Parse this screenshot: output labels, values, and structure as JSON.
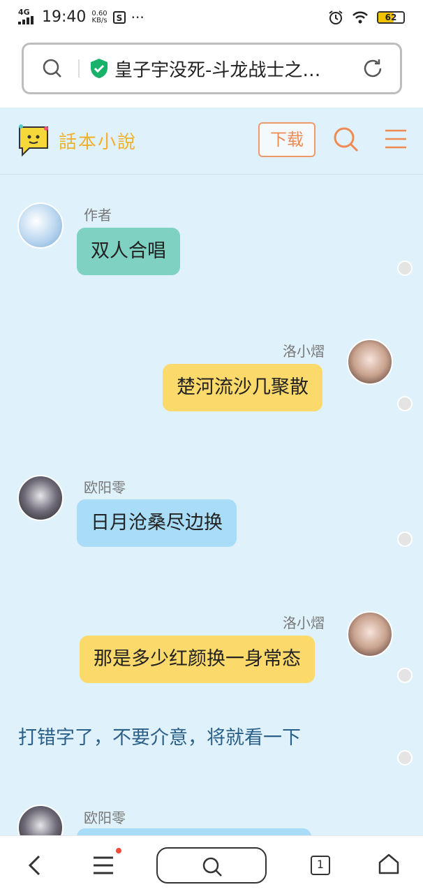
{
  "status_bar": {
    "network": "4G",
    "time": "19:40",
    "speed_value": "0.60",
    "speed_unit": "KB/s",
    "more": "···",
    "battery_level": "62"
  },
  "address_bar": {
    "page_title": "皇子宇没死-斗龙战士之…"
  },
  "site_header": {
    "logo_text": "話本小說",
    "download_label": "下载"
  },
  "messages": [
    {
      "name": "作者",
      "text": "双人合唱",
      "side": "left",
      "color": "#7fd1c2"
    },
    {
      "name": "洛小熠",
      "text": "楚河流沙几聚散",
      "side": "right",
      "color": "#fbd96b"
    },
    {
      "name": "欧阳零",
      "text": "日月沧桑尽边换",
      "side": "left",
      "color": "#a8dcf7"
    },
    {
      "name": "洛小熠",
      "text": "那是多少红颜换一身常态",
      "side": "right",
      "color": "#fbd96b"
    },
    {
      "name": "欧阳零",
      "text": "",
      "side": "left",
      "color": "#a8dcf7"
    }
  ],
  "note_text": "打错字了，不要介意，将就看一下",
  "bottom_nav": {
    "tab_count": "1"
  }
}
